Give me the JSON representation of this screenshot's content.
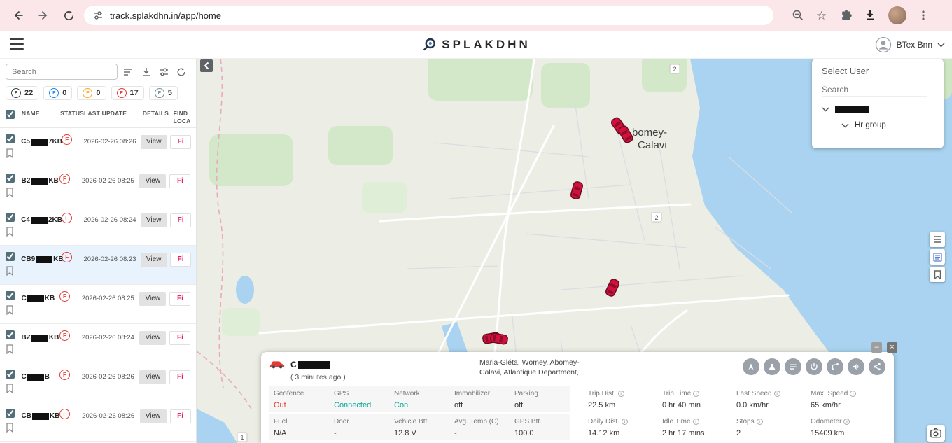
{
  "browser": {
    "url": "track.splakdhn.in/app/home"
  },
  "header": {
    "logo_text": "SPLAKDHN",
    "user_name": "BTex Bnn"
  },
  "sidebar": {
    "search_placeholder": "Search",
    "chip_letter": "F",
    "status_letter": "F",
    "chips": [
      {
        "count": "22",
        "color": "#37474f"
      },
      {
        "count": "0",
        "color": "#1e88e5"
      },
      {
        "count": "0",
        "color": "#f9a825"
      },
      {
        "count": "17",
        "color": "#e53935"
      },
      {
        "count": "5",
        "color": "#78909c"
      }
    ],
    "columns": [
      "NAME",
      "STATUS",
      "LAST UPDATE",
      "DETAILS",
      "FIND LOCA"
    ],
    "view_label": "View",
    "find_label": "Fi",
    "rows": [
      {
        "prefix": "C5",
        "suffix": "7KB",
        "last_update": "2026-02-26 08:26",
        "selected": false
      },
      {
        "prefix": "B2",
        "suffix": "KB",
        "last_update": "2026-02-26 08:25",
        "selected": false
      },
      {
        "prefix": "C4",
        "suffix": "2KB",
        "last_update": "2026-02-26 08:24",
        "selected": false
      },
      {
        "prefix": "CB9",
        "suffix": "KB",
        "last_update": "2026-02-26 08:23",
        "selected": true
      },
      {
        "prefix": "C",
        "suffix": "KB",
        "last_update": "2026-02-26 08:25",
        "selected": false
      },
      {
        "prefix": "BZ",
        "suffix": "KB",
        "last_update": "2026-02-26 08:24",
        "selected": false
      },
      {
        "prefix": "C",
        "suffix": "B",
        "last_update": "2026-02-26 08:26",
        "selected": false
      },
      {
        "prefix": "CB",
        "suffix": "KB",
        "last_update": "2026-02-26 08:26",
        "selected": false
      }
    ]
  },
  "select_user": {
    "title": "Select User",
    "search_placeholder": "Search",
    "group_label": "Hr group"
  },
  "map": {
    "place_label": [
      "bomey-",
      "Calavi"
    ],
    "road_shields": [
      "2",
      "2",
      "1"
    ]
  },
  "detail_panel": {
    "vehicle_prefix": "C",
    "time_ago": "( 3 minutes ago )",
    "address": [
      "Maria-Gléta, Womey, Abomey-",
      "Calavi, Atlantique Department,..."
    ],
    "minimize_glyph": "–",
    "close_glyph": "×",
    "stats_row1": [
      {
        "label": "Geofence",
        "value": "Out",
        "color": "#e53935"
      },
      {
        "label": "GPS",
        "value": "Connected",
        "color": "#00a693"
      },
      {
        "label": "Network",
        "value": "Con.",
        "color": "#00a693"
      },
      {
        "label": "Immobilizer",
        "value": "off"
      },
      {
        "label": "Parking",
        "value": "off"
      },
      {
        "label": "Trip Dist.",
        "value": "22.5 km",
        "info": true
      },
      {
        "label": "Trip Time",
        "value": "0 hr 40 min",
        "info": true
      },
      {
        "label": "Last Speed",
        "value": "0.0 km/hr",
        "info": true
      },
      {
        "label": "Max. Speed",
        "value": "65 km/hr",
        "info": true
      }
    ],
    "stats_row2": [
      {
        "label": "Fuel",
        "value": "N/A"
      },
      {
        "label": "Door",
        "value": "-"
      },
      {
        "label": "Vehicle Btt.",
        "value": "12.8 V"
      },
      {
        "label": "Avg. Temp (C)",
        "value": "-"
      },
      {
        "label": "GPS Btt.",
        "value": "100.0"
      },
      {
        "label": "Daily Dist.",
        "value": "14.12 km",
        "info": true
      },
      {
        "label": "Idle Time",
        "value": "2 hr 17 mins",
        "info": true
      },
      {
        "label": "Stops",
        "value": "2",
        "info": true
      },
      {
        "label": "Odometer",
        "value": "15409 km",
        "info": true
      }
    ]
  }
}
